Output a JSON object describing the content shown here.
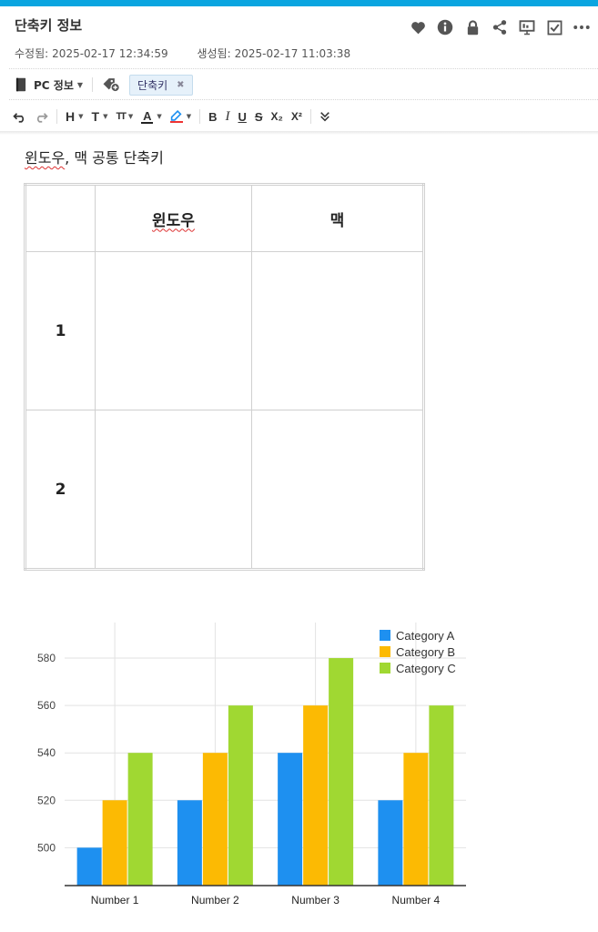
{
  "page": {
    "title": "단축키 정보",
    "modified_label": "수정됨:",
    "modified_value": "2025-02-17 12:34:59",
    "created_label": "생성됨:",
    "created_value": "2025-02-17 11:03:38"
  },
  "header_icons": [
    "heart-icon",
    "info-icon",
    "lock-icon",
    "share-icon",
    "presentation-icon",
    "checkbox-icon",
    "more-icon"
  ],
  "notebook": {
    "label": "PC 정보"
  },
  "tags": [
    {
      "label": "단축키"
    }
  ],
  "toolbar": {
    "heading": "H",
    "text_style": "T",
    "font_size": "TT",
    "font_color": "A",
    "bold": "B",
    "italic": "I",
    "underline": "U",
    "strike": "S",
    "subscript": "X₂",
    "superscript": "X²"
  },
  "content": {
    "heading_word": "윈도우",
    "heading_rest": ", 맥 공통 단축키",
    "table": {
      "headers": [
        "",
        "윈도우",
        "맥"
      ],
      "rows": [
        [
          "1",
          "",
          ""
        ],
        [
          "2",
          "",
          ""
        ]
      ]
    }
  },
  "colors": {
    "series": [
      "#1e90f0",
      "#fcba03",
      "#a0d832"
    ],
    "accent": "#0aa5e0"
  },
  "chart_data": {
    "type": "bar",
    "categories": [
      "Number 1",
      "Number 2",
      "Number 3",
      "Number 4"
    ],
    "series": [
      {
        "name": "Category A",
        "values": [
          500,
          520,
          540,
          520
        ]
      },
      {
        "name": "Category B",
        "values": [
          520,
          540,
          560,
          540
        ]
      },
      {
        "name": "Category C",
        "values": [
          540,
          560,
          580,
          560
        ]
      }
    ],
    "ylim": [
      484,
      595
    ],
    "yticks": [
      500,
      520,
      540,
      560,
      580
    ],
    "grid": true,
    "legend": "top-right"
  }
}
